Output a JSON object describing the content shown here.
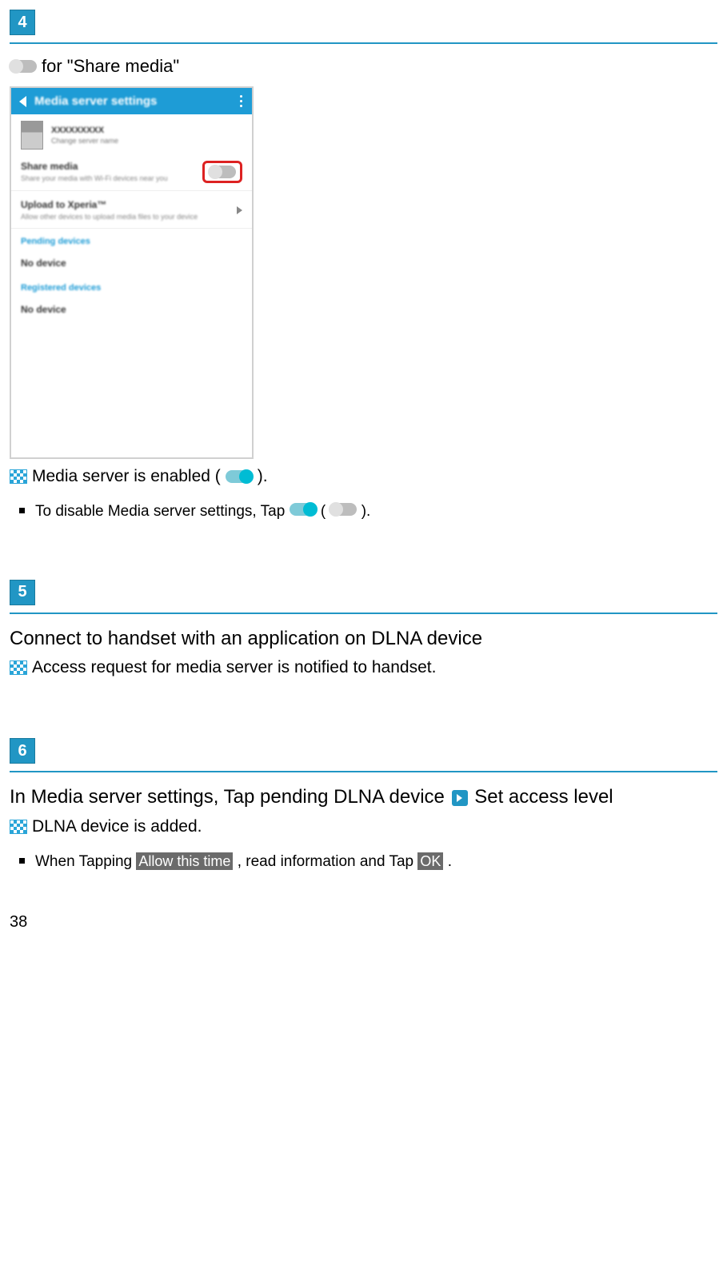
{
  "step4": {
    "badge": "4",
    "line_for": " for \"Share media\"",
    "enabled_prefix": " Media server is enabled (",
    "enabled_suffix": ").",
    "bullet_prefix": "To disable Media server settings, Tap ",
    "bullet_mid": " (",
    "bullet_suffix": ")."
  },
  "screenshot": {
    "header": "Media server settings",
    "username": "XXXXXXXXX",
    "usersub": "Change server name",
    "share_title": "Share media",
    "share_sub": "Share your media with Wi-Fi devices near you",
    "upload_title": "Upload to Xperia™",
    "upload_sub": "Allow other devices to upload media files to your device",
    "pending": "Pending devices",
    "nodevice1": "No device",
    "registered": "Registered devices",
    "nodevice2": "No device"
  },
  "step5": {
    "badge": "5",
    "main": "Connect to handset with an application on DLNA device",
    "result": " Access request for media server is notified to handset."
  },
  "step6": {
    "badge": "6",
    "main_prefix": "In Media server settings, Tap pending DLNA device",
    "main_suffix": " Set access level",
    "result": " DLNA device is added.",
    "bullet_prefix": "When Tapping ",
    "key1": "Allow this time",
    "bullet_mid": ", read information and Tap ",
    "key2": "OK",
    "bullet_suffix": "."
  },
  "page_number": "38"
}
